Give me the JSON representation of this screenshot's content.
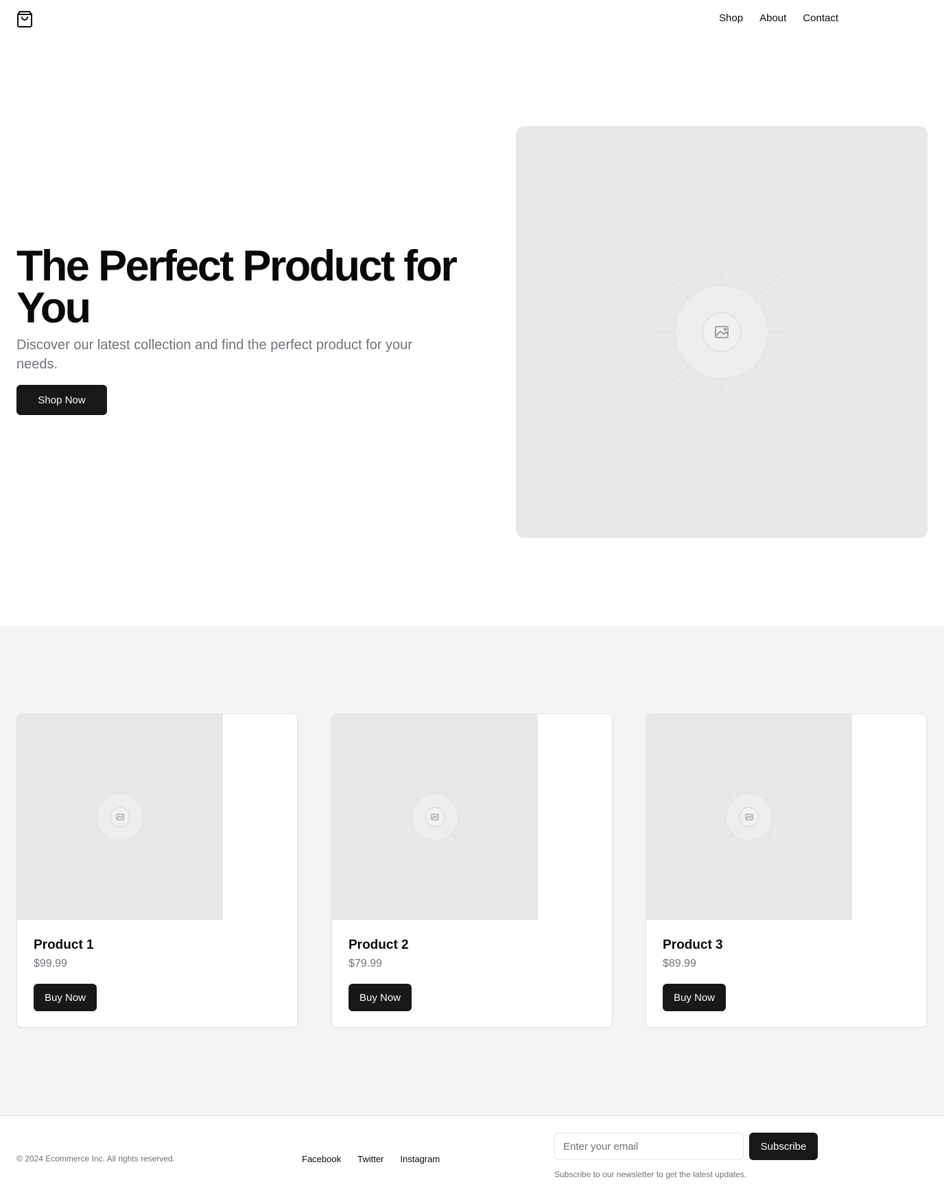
{
  "header": {
    "logo_icon": "shopping-bag-icon",
    "nav": [
      {
        "label": "Shop"
      },
      {
        "label": "About"
      },
      {
        "label": "Contact"
      }
    ]
  },
  "hero": {
    "title": "The Perfect Product for You",
    "subtitle": "Discover our latest collection and find the perfect product for your needs.",
    "cta_label": "Shop Now",
    "image_icon": "image-placeholder-icon"
  },
  "products": [
    {
      "name": "Product 1",
      "price": "$99.99",
      "button_label": "Buy Now"
    },
    {
      "name": "Product 2",
      "price": "$79.99",
      "button_label": "Buy Now"
    },
    {
      "name": "Product 3",
      "price": "$89.99",
      "button_label": "Buy Now"
    }
  ],
  "footer": {
    "copyright": "© 2024 Ecommerce Inc. All rights reserved.",
    "social": [
      {
        "label": "Facebook"
      },
      {
        "label": "Twitter"
      },
      {
        "label": "Instagram"
      }
    ],
    "email_placeholder": "Enter your email",
    "subscribe_label": "Subscribe",
    "newsletter_note": "Subscribe to our newsletter to get the latest updates."
  },
  "colors": {
    "primary": "#18181b",
    "muted_text": "#71717a",
    "section_bg": "#f3f4f6",
    "placeholder_bg": "#e8e8e8"
  }
}
